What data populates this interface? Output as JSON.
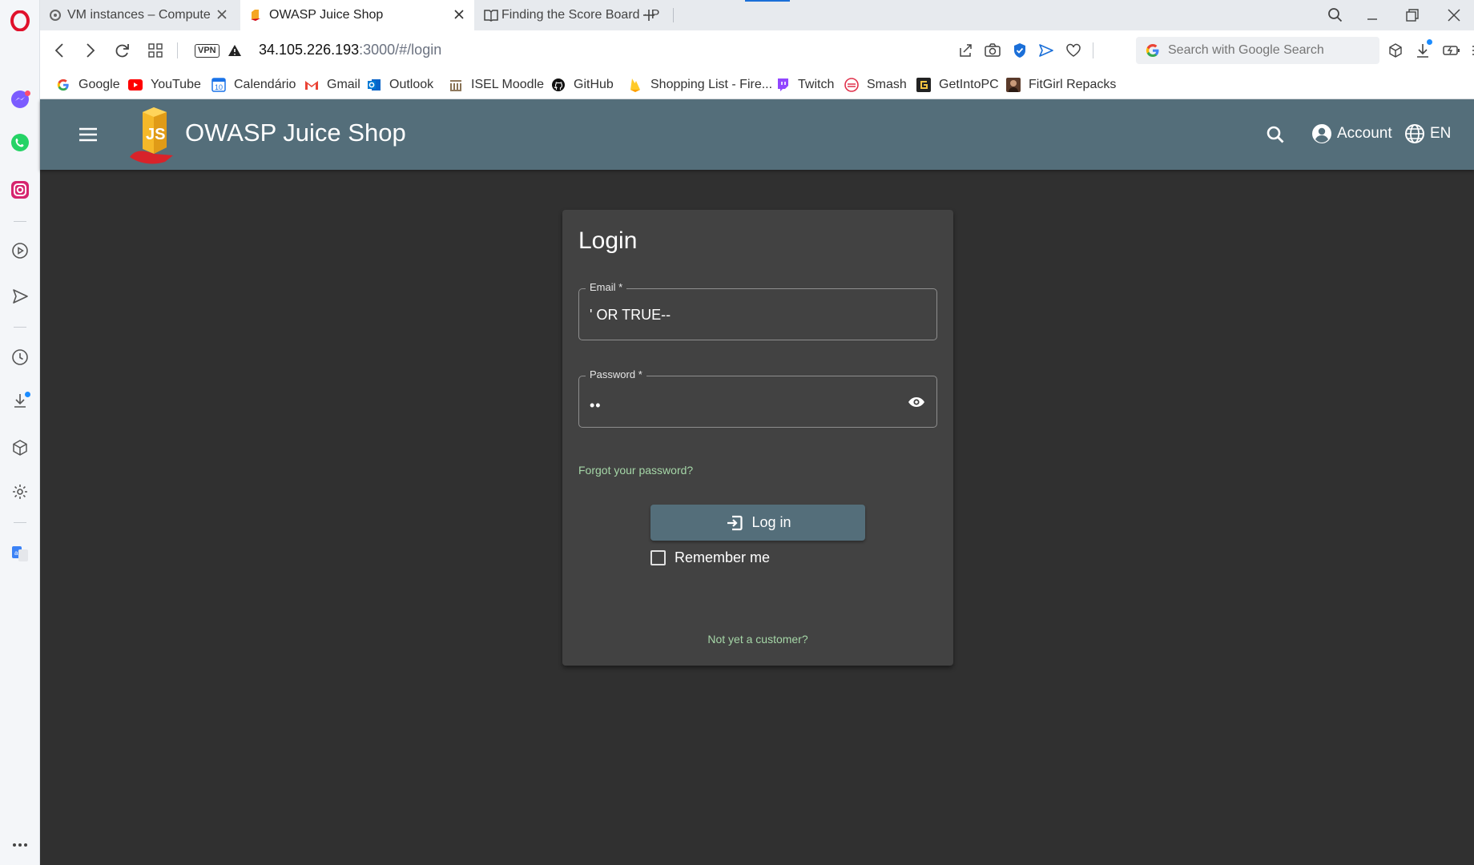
{
  "browser": {
    "tabs": [
      {
        "title": "VM instances – Compute Er",
        "icon": "gcp-icon",
        "active": false
      },
      {
        "title": "OWASP Juice Shop",
        "icon": "juice-shop-icon",
        "active": true
      },
      {
        "title": "Finding the Score Board · P",
        "icon": "book-icon",
        "active": false
      }
    ],
    "new_tab_label": "+",
    "vpn_label": "VPN",
    "url_host": "34.105.226.193",
    "url_rest": ":3000/#/login",
    "search_placeholder": "Search with Google Search",
    "bookmarks": [
      {
        "label": "Google",
        "icon": "google-icon"
      },
      {
        "label": "YouTube",
        "icon": "youtube-icon"
      },
      {
        "label": "Calendário",
        "icon": "calendar-icon",
        "badge": "10"
      },
      {
        "label": "Gmail",
        "icon": "gmail-icon"
      },
      {
        "label": "Outlook",
        "icon": "outlook-icon"
      },
      {
        "label": "ISEL Moodle",
        "icon": "moodle-icon"
      },
      {
        "label": "GitHub",
        "icon": "github-icon"
      },
      {
        "label": "Shopping List - Fire...",
        "icon": "firebase-icon"
      },
      {
        "label": "Twitch",
        "icon": "twitch-icon"
      },
      {
        "label": "Smash",
        "icon": "smash-icon"
      },
      {
        "label": "GetIntoPC",
        "icon": "getintopc-icon"
      },
      {
        "label": "FitGirl Repacks",
        "icon": "fitgirl-icon"
      }
    ]
  },
  "app": {
    "title": "OWASP Juice Shop",
    "account_label": "Account",
    "language_label": "EN",
    "toolbar_color": "#546e7a",
    "background_color": "#303030"
  },
  "login": {
    "heading": "Login",
    "email_label": "Email *",
    "email_value": "' OR TRUE--",
    "password_label": "Password *",
    "password_masked": "••",
    "forgot_link": "Forgot your password?",
    "login_button": "Log in",
    "remember_label": "Remember me",
    "remember_checked": false,
    "register_link": "Not yet a customer?",
    "link_color": "#a5d6a7"
  }
}
